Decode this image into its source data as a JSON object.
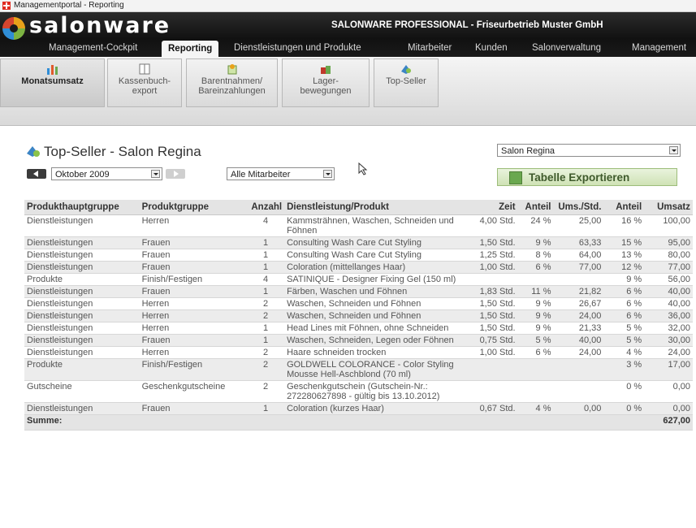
{
  "window": {
    "title": "Managementportal - Reporting"
  },
  "header": {
    "logo": "salonware",
    "company": "SALONWARE PROFESSIONAL - Friseurbetrieb Muster GmbH",
    "nav": [
      {
        "label": "Management-Cockpit",
        "active": false
      },
      {
        "label": "Reporting",
        "active": true
      },
      {
        "label": "Dienstleistungen und Produkte",
        "active": false
      },
      {
        "label": "Mitarbeiter",
        "active": false
      },
      {
        "label": "Kunden",
        "active": false
      },
      {
        "label": "Salonverwaltung",
        "active": false
      },
      {
        "label": "Management",
        "active": false
      }
    ]
  },
  "toolbar": {
    "buttons": [
      {
        "line1": "Monatsumsatz",
        "line2": "",
        "icon": "bar-chart-icon",
        "selected": true
      },
      {
        "line1": "Kassenbuch-",
        "line2": "export",
        "icon": "ledger-icon",
        "selected": false
      },
      {
        "line1": "Barentnahmen/",
        "line2": "Bareinzahlungen",
        "icon": "cash-icon",
        "selected": false
      },
      {
        "line1": "Lager-",
        "line2": "bewegungen",
        "icon": "warehouse-icon",
        "selected": false
      },
      {
        "line1": "Top-Seller",
        "line2": "",
        "icon": "top-seller-icon",
        "selected": false
      }
    ]
  },
  "page": {
    "title": "Top-Seller - Salon Regina",
    "month_select": "Oktober 2009",
    "employee_select": "Alle Mitarbeiter",
    "salon_select": "Salon Regina",
    "export_label": "Tabelle Exportieren"
  },
  "table": {
    "headers": [
      "Produkthauptgruppe",
      "Produktgruppe",
      "Anzahl",
      "Dienstleistung/Produkt",
      "Zeit",
      "Anteil",
      "Ums./Std.",
      "Anteil",
      "Umsatz"
    ],
    "rows": [
      [
        "Dienstleistungen",
        "Herren",
        "4",
        "Kammsträhnen, Waschen, Schneiden und Föhnen",
        "4,00 Std.",
        "24 %",
        "25,00",
        "16 %",
        "100,00"
      ],
      [
        "Dienstleistungen",
        "Frauen",
        "1",
        "Consulting Wash Care Cut Styling",
        "1,50 Std.",
        "9 %",
        "63,33",
        "15 %",
        "95,00"
      ],
      [
        "Dienstleistungen",
        "Frauen",
        "1",
        "Consulting Wash Care Cut Styling",
        "1,25 Std.",
        "8 %",
        "64,00",
        "13 %",
        "80,00"
      ],
      [
        "Dienstleistungen",
        "Frauen",
        "1",
        "Coloration (mittellanges Haar)",
        "1,00 Std.",
        "6 %",
        "77,00",
        "12 %",
        "77,00"
      ],
      [
        "Produkte",
        "Finish/Festigen",
        "4",
        "SATINIQUE - Designer Fixing Gel (150 ml)",
        "",
        "",
        "",
        "9 %",
        "56,00"
      ],
      [
        "Dienstleistungen",
        "Frauen",
        "1",
        "Färben, Waschen und Föhnen",
        "1,83 Std.",
        "11 %",
        "21,82",
        "6 %",
        "40,00"
      ],
      [
        "Dienstleistungen",
        "Herren",
        "2",
        "Waschen, Schneiden und Föhnen",
        "1,50 Std.",
        "9 %",
        "26,67",
        "6 %",
        "40,00"
      ],
      [
        "Dienstleistungen",
        "Herren",
        "2",
        "Waschen, Schneiden und Föhnen",
        "1,50 Std.",
        "9 %",
        "24,00",
        "6 %",
        "36,00"
      ],
      [
        "Dienstleistungen",
        "Herren",
        "1",
        "Head Lines mit Föhnen, ohne Schneiden",
        "1,50 Std.",
        "9 %",
        "21,33",
        "5 %",
        "32,00"
      ],
      [
        "Dienstleistungen",
        "Frauen",
        "1",
        "Waschen, Schneiden, Legen oder Föhnen",
        "0,75 Std.",
        "5 %",
        "40,00",
        "5 %",
        "30,00"
      ],
      [
        "Dienstleistungen",
        "Herren",
        "2",
        "Haare schneiden trocken",
        "1,00 Std.",
        "6 %",
        "24,00",
        "4 %",
        "24,00"
      ],
      [
        "Produkte",
        "Finish/Festigen",
        "2",
        "GOLDWELL COLORANCE - Color Styling Mousse Hell-Aschblond (70 ml)",
        "",
        "",
        "",
        "3 %",
        "17,00"
      ],
      [
        "Gutscheine",
        "Geschenkgutscheine",
        "2",
        "Geschenkgutschein (Gutschein-Nr.: 272280627898 - gültig bis 13.10.2012)",
        "",
        "",
        "",
        "0 %",
        "0,00"
      ],
      [
        "Dienstleistungen",
        "Frauen",
        "1",
        "Coloration (kurzes Haar)",
        "0,67 Std.",
        "4 %",
        "0,00",
        "0 %",
        "0,00"
      ]
    ],
    "sum_label": "Summe:",
    "sum_value": "627,00"
  }
}
